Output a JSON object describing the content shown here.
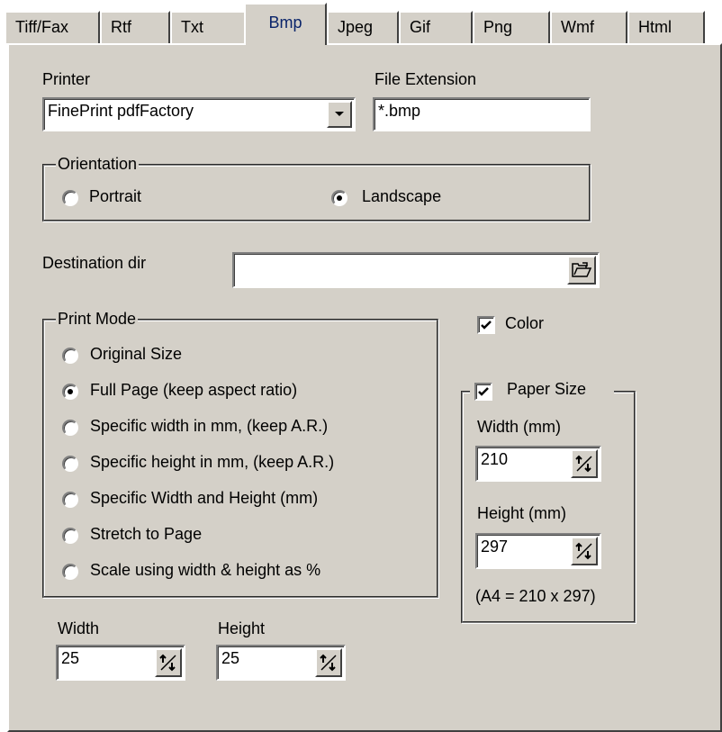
{
  "tabs": [
    {
      "label": "Tiff/Fax"
    },
    {
      "label": "Rtf"
    },
    {
      "label": "Txt"
    },
    {
      "label": "Bmp"
    },
    {
      "label": "Jpeg"
    },
    {
      "label": "Gif"
    },
    {
      "label": "Png"
    },
    {
      "label": "Wmf"
    },
    {
      "label": "Html"
    }
  ],
  "printer": {
    "label": "Printer",
    "value": "FinePrint pdfFactory"
  },
  "file_extension": {
    "label": "File Extension",
    "value": "*.bmp"
  },
  "orientation": {
    "title": "Orientation",
    "portrait": "Portrait",
    "landscape": "Landscape",
    "selected": "Landscape"
  },
  "destination": {
    "label": "Destination dir",
    "value": ""
  },
  "print_mode": {
    "title": "Print Mode",
    "options": [
      "Original Size",
      "Full Page (keep aspect ratio)",
      "Specific width in mm, (keep A.R.)",
      "Specific height in mm, (keep A.R.)",
      "Specific Width and Height (mm)",
      "Stretch to Page",
      "Scale using width & height as %"
    ],
    "selected_index": 1
  },
  "color": {
    "label": "Color",
    "checked": true
  },
  "paper_size": {
    "label": "Paper Size",
    "checked": true,
    "width_label": "Width (mm)",
    "width_value": "210",
    "height_label": "Height (mm)",
    "height_value": "297",
    "note": "(A4 = 210 x 297)"
  },
  "size": {
    "width_label": "Width",
    "width_value": "25",
    "height_label": "Height",
    "height_value": "25"
  },
  "colors": {
    "face": "#d4d0c8",
    "active_tab_text": "#0a246a"
  }
}
